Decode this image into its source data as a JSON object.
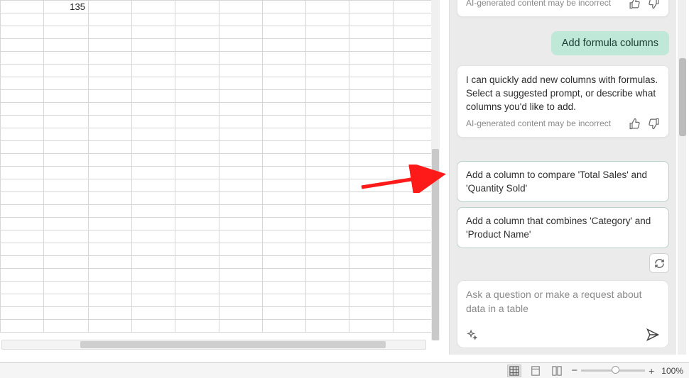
{
  "sheet": {
    "cell_c1_value": "135"
  },
  "copilot": {
    "partial_disclaimer": "AI-generated content may be incorrect",
    "user_msg": "Add formula columns",
    "assistant_msg": "I can quickly add new columns with formulas. Select a suggested prompt, or describe what columns you'd like to add.",
    "assistant_disclaimer": "AI-generated content may be incorrect",
    "suggestions": {
      "s1": "Add a column to compare 'Total Sales' and 'Quantity Sold'",
      "s2": "Add a column that combines 'Category' and 'Product Name'"
    },
    "input_placeholder": "Ask a question or make a request about data in a table"
  },
  "statusbar": {
    "zoom_label": "100%",
    "zoom_minus": "−",
    "zoom_plus": "+"
  }
}
